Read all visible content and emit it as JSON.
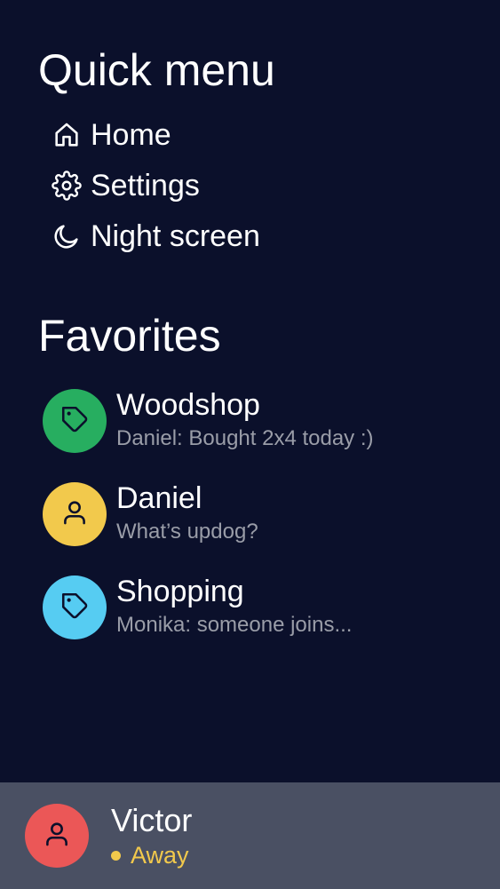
{
  "quick_menu": {
    "title": "Quick menu",
    "items": [
      {
        "label": "Home",
        "icon": "home-icon"
      },
      {
        "label": "Settings",
        "icon": "gear-icon"
      },
      {
        "label": "Night screen",
        "icon": "moon-icon"
      }
    ]
  },
  "favorites": {
    "title": "Favorites",
    "items": [
      {
        "name": "Woodshop",
        "preview": "Daniel: Bought 2x4 today :)",
        "icon": "tag-icon",
        "color": "#27ae60"
      },
      {
        "name": "Daniel",
        "preview": "What’s updog?",
        "icon": "user-icon",
        "color": "#f2c94c"
      },
      {
        "name": "Shopping",
        "preview": "Monika: someone joins...",
        "icon": "tag-icon",
        "color": "#56ccf2"
      }
    ]
  },
  "current_user": {
    "name": "Victor",
    "status": "Away",
    "status_color": "#f2c94c",
    "avatar_color": "#eb5757",
    "icon": "user-icon"
  },
  "colors": {
    "background": "#0b102b",
    "user_bar": "#4a5063",
    "muted_text": "#9a9da8"
  }
}
